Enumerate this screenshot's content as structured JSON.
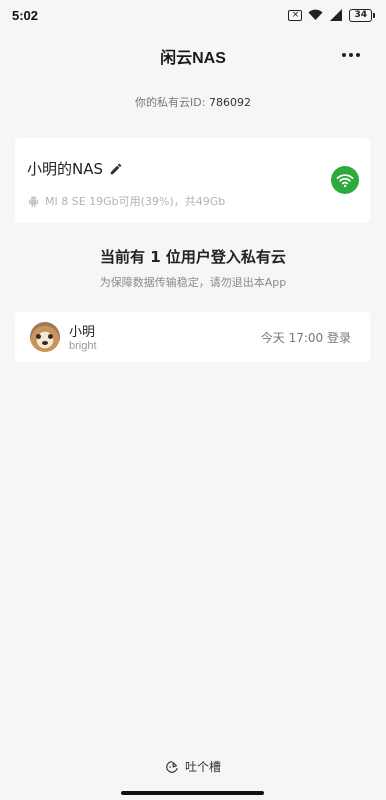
{
  "status_bar": {
    "time": "5:02",
    "sim_icon_text": "×",
    "battery_level": "34"
  },
  "header": {
    "title": "闲云NAS"
  },
  "cloud_id": {
    "label": "你的私有云ID:",
    "value": "786092"
  },
  "nas_card": {
    "name": "小明的NAS",
    "device_info": "MI 8 SE  19Gb可用(39%)，共49Gb",
    "status_color": "#2eaa3a"
  },
  "users_section": {
    "heading": "当前有 1 位用户登入私有云",
    "subheading": "为保障数据传输稳定，请勿退出本App",
    "users": [
      {
        "name": "小明",
        "sub": "bright",
        "login_time": "今天 17:00 登录"
      }
    ]
  },
  "feedback": {
    "label": "吐个槽"
  },
  "icons": {
    "edit": "pencil-icon",
    "wifi": "wifi-icon",
    "android": "android-icon",
    "feedback": "feedback-icon",
    "more": "more-icon"
  }
}
